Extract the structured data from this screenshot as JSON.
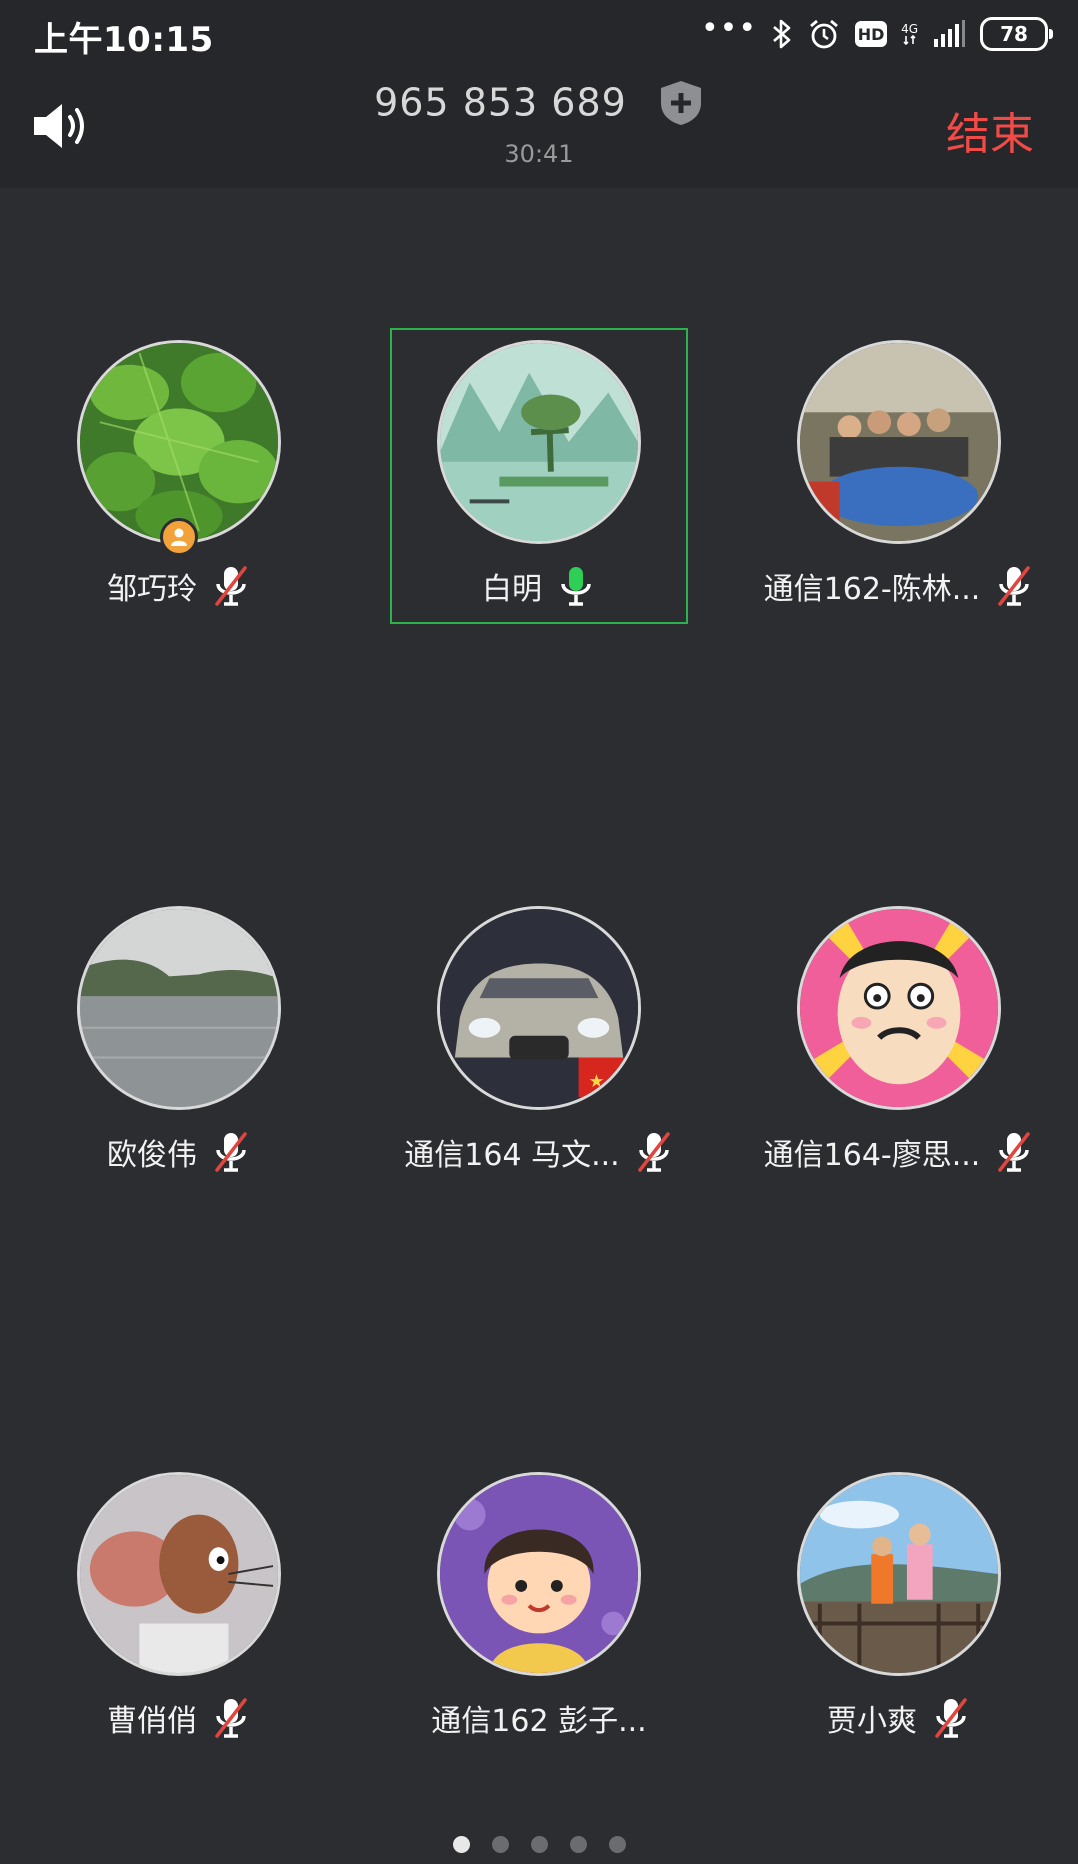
{
  "status_bar": {
    "time": "上午10:15",
    "dots": "•••",
    "hd": "HD",
    "network": "4G",
    "battery": "78"
  },
  "call": {
    "number": "965 853 689",
    "duration": "30:41",
    "end_label": "结束"
  },
  "participants": [
    {
      "name": "邹巧玲",
      "mic": "muted",
      "host": true
    },
    {
      "name": "白明",
      "mic": "speaking",
      "host": false
    },
    {
      "name": "通信162-陈林...",
      "mic": "muted",
      "host": false
    },
    {
      "name": "欧俊伟",
      "mic": "muted",
      "host": false
    },
    {
      "name": "通信164 马文...",
      "mic": "muted",
      "host": false
    },
    {
      "name": "通信164-廖思...",
      "mic": "muted",
      "host": false
    },
    {
      "name": "曹俏俏",
      "mic": "muted",
      "host": false
    },
    {
      "name": "通信162 彭子...",
      "mic": "none",
      "host": false
    },
    {
      "name": "贾小爽",
      "mic": "muted",
      "host": false
    }
  ],
  "pager": {
    "pages": 5,
    "current": 1
  },
  "colors": {
    "background": "#2b2d30",
    "header": "#25272a",
    "end": "#f04b47",
    "speaking": "#2bb24c",
    "host_badge": "#f2a23a",
    "mute_slash": "#e0463f"
  }
}
